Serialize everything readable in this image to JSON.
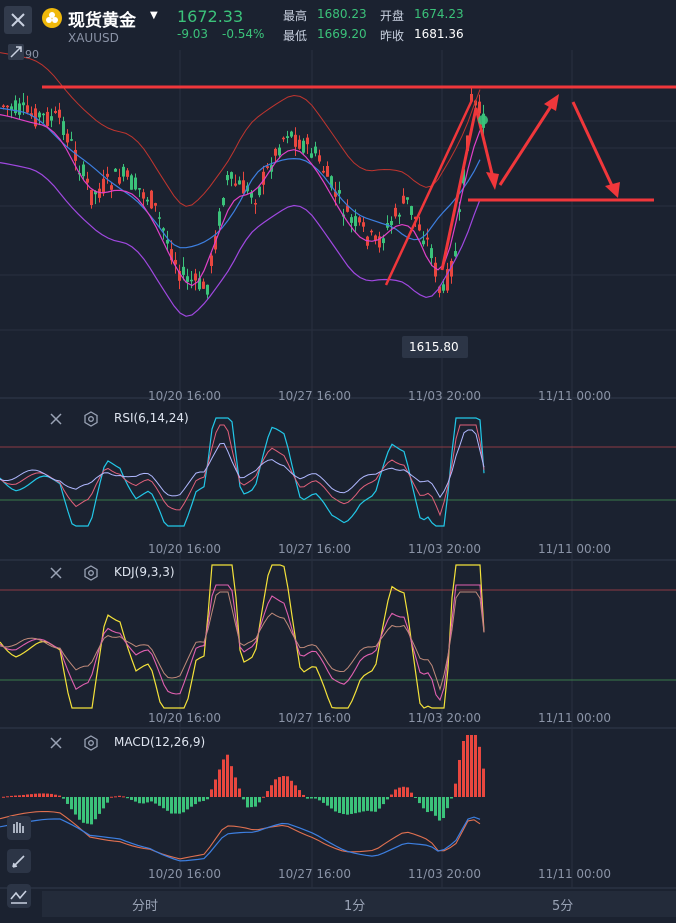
{
  "header": {
    "title": "现货黄金",
    "symbol": "XAUUSD",
    "price": "1672.33",
    "change": "-9.03",
    "change_pct": "-0.54%",
    "high_label": "最高",
    "high_value": "1680.23",
    "open_label": "开盘",
    "open_value": "1674.23",
    "low_label": "最低",
    "low_value": "1669.20",
    "prev_close_label": "昨收",
    "prev_close_value": "1681.36",
    "left_edge_value": "90"
  },
  "main_chart": {
    "low_marker": "1615.80",
    "x_labels": [
      "10/20 16:00",
      "10/27 16:00",
      "11/03 20:00",
      "11/11 00:00"
    ]
  },
  "panels": [
    {
      "name": "RSI(6,14,24)",
      "x_labels": [
        "10/20 16:00",
        "10/27 16:00",
        "11/03 20:00",
        "11/11 00:00"
      ]
    },
    {
      "name": "KDJ(9,3,3)",
      "x_labels": [
        "10/20 16:00",
        "10/27 16:00",
        "11/03 20:00",
        "11/11 00:00"
      ]
    },
    {
      "name": "MACD(12,26,9)",
      "x_labels": [
        "10/20 16:00",
        "10/27 16:00",
        "11/03 20:00",
        "11/11 00:00"
      ]
    }
  ],
  "tabs": [
    "分时",
    "1分",
    "5分"
  ],
  "colors": {
    "up": "#3bc27a",
    "down": "#e8473f",
    "background": "#1b2230",
    "annotation": "#f0373b",
    "rsi_cyan": "#22c8e8",
    "kdj_yellow": "#f4e23a",
    "purple": "#a048e0",
    "blue": "#3d7fe0",
    "magenta": "#e040c8"
  }
}
